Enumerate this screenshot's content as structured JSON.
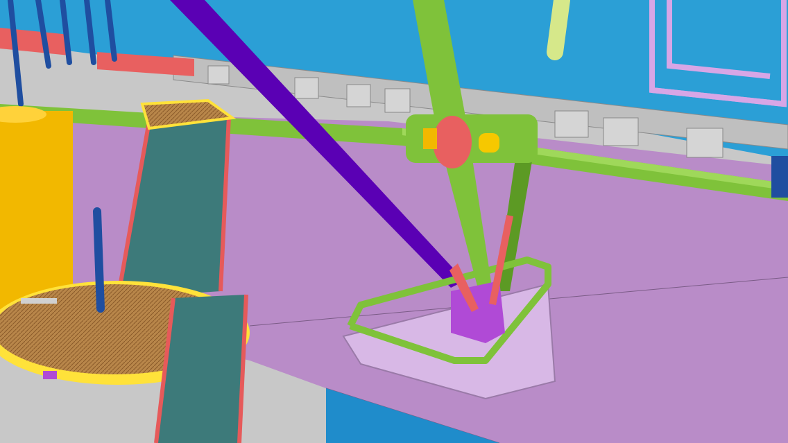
{
  "scene": {
    "colors": {
      "deck_top": "#2b9fd6",
      "deck_side": "#1f8ccb",
      "floor": "#b98cc8",
      "floor_edge": "#7a5b86",
      "beam_green": "#7fc23a",
      "beam_green_dark": "#5c9a24",
      "brace_purple": "#5a00b4",
      "column_blue": "#1f4ea0",
      "tank_yellow": "#f2b800",
      "stair_red": "#e65a5a",
      "grating": "#b8864a",
      "platform_yellow": "#ffe23a",
      "rail_gray": "#d0d0d0",
      "pipe_lightgreen": "#d6e88a",
      "base_magenta": "#b04ad6",
      "coupler_red": "#e86060",
      "lavender_frame": "#d7a6e6"
    }
  }
}
